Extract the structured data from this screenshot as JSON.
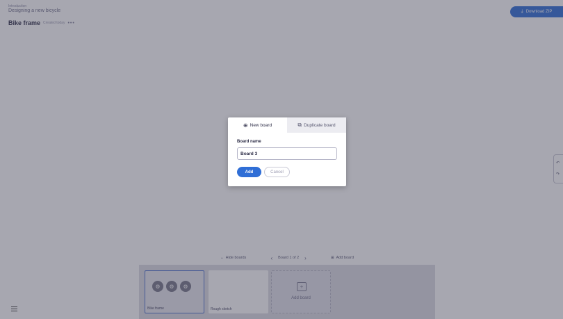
{
  "header": {
    "breadcrumb": "Introduction",
    "project_title": "Designing a new bicycle",
    "board_title": "Bike frame",
    "board_date": "Created today",
    "more_icon": "more-dots-icon"
  },
  "download": {
    "label": "Download ZIP",
    "icon": "download-icon"
  },
  "toolbar": {
    "hide_boards": "Hide boards",
    "pager": "Board 1 of 2",
    "add_board": "Add board"
  },
  "boards": [
    {
      "label": "Bike frame"
    },
    {
      "label": "Rough sketch"
    }
  ],
  "add_board_tile": {
    "label": "Add board"
  },
  "modal": {
    "tab_new": "New board",
    "tab_duplicate": "Duplicate board",
    "field_label": "Board name",
    "input_value": "Board 3",
    "add_label": "Add",
    "cancel_label": "Cancel"
  },
  "colors": {
    "accent": "#2f6ed6",
    "overlay": "#404052",
    "modal_bg": "#ffffff",
    "inactive_tab": "#ececf1"
  }
}
